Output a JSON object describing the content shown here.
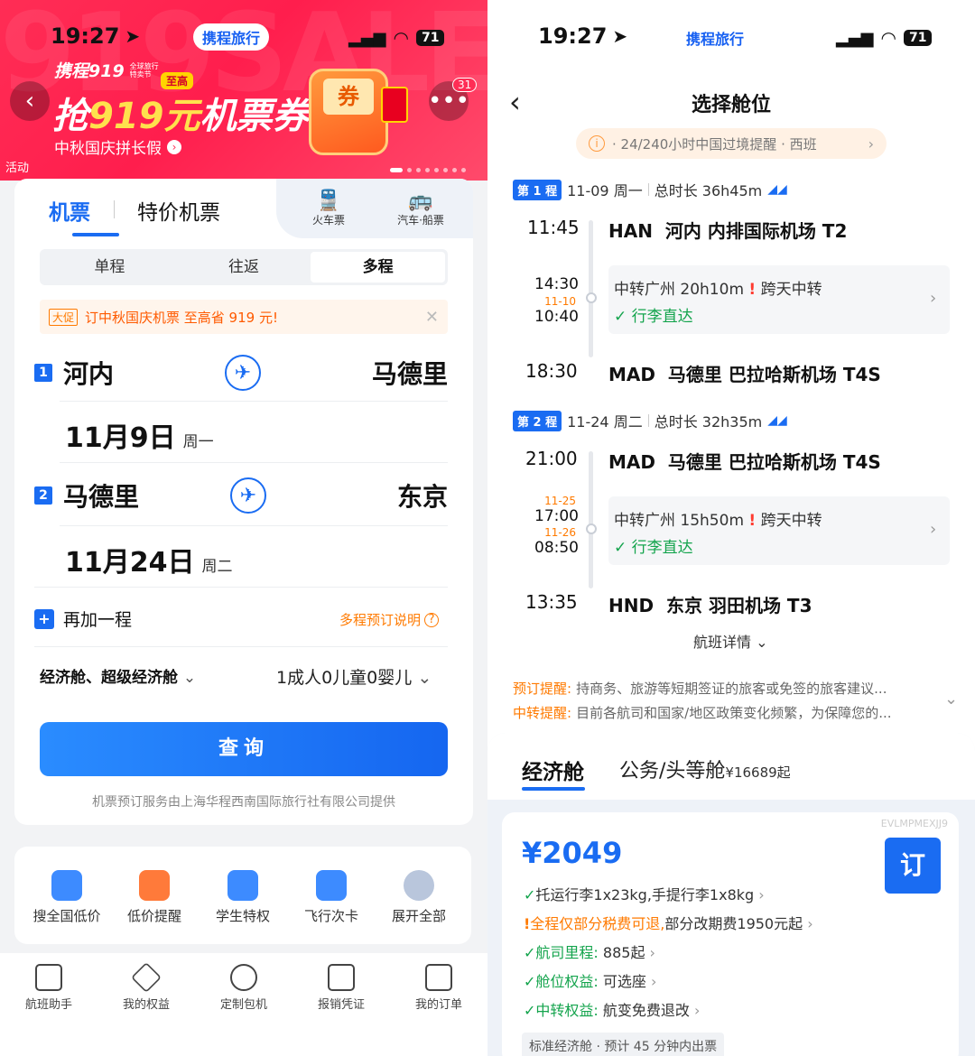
{
  "left": {
    "status": {
      "time": "19:27",
      "app": "携程旅行",
      "battery": "71"
    },
    "banner": {
      "brand": "携程919",
      "brand_sub": "全球旅行特卖节",
      "badge": "至高",
      "headline_pre": "抢",
      "headline_num": "919元",
      "headline_post": "机票券!",
      "sub": "中秋国庆拼长假",
      "tag": "活动",
      "notif_count": "31",
      "coupon_text": "券"
    },
    "tabs": {
      "flight": "机票",
      "special": "特价机票",
      "train": "火车票",
      "bus": "汽车·船票"
    },
    "trip_types": [
      "单程",
      "往返",
      "多程"
    ],
    "promo": {
      "tag": "大促",
      "text": "订中秋国庆机票 至高省 919 元!"
    },
    "legs": [
      {
        "num": "1",
        "from": "河内",
        "to": "马德里",
        "date": "11月9日",
        "weekday": "周一"
      },
      {
        "num": "2",
        "from": "马德里",
        "to": "东京",
        "date": "11月24日",
        "weekday": "周二"
      }
    ],
    "add_leg": "再加一程",
    "multi_help": "多程预订说明",
    "cabin": "经济舱、超级经济舱",
    "passengers": "1成人0儿童0婴儿",
    "search_btn": "查询",
    "provider": "机票预订服务由上海华程西南国际旅行社有限公司提供",
    "entries": [
      "搜全国低价",
      "低价提醒",
      "学生特权",
      "飞行次卡",
      "展开全部"
    ],
    "bottom_tabs": [
      "航班助手",
      "我的权益",
      "定制包机",
      "报销凭证",
      "我的订单"
    ]
  },
  "right": {
    "status": {
      "time": "19:27",
      "app": "携程旅行",
      "battery": "71"
    },
    "title": "选择舱位",
    "notice": "· 24/240小时中国过境提醒 · 西班",
    "segments": [
      {
        "badge": "第 1 程",
        "date": "11-09 周一",
        "duration": "总时长 36h45m",
        "dep_time": "11:45",
        "dep_airport": "HAN  河内 内排国际机场 T2",
        "tr_arr_time": "14:30",
        "tr_dep_date": "11-10",
        "tr_dep_time": "10:40",
        "tr_arr_date": "",
        "transfer": "中转广州 20h10m",
        "transfer_warn": "跨天中转",
        "baggage": "行李直达",
        "arr_time": "18:30",
        "arr_airport": "MAD  马德里 巴拉哈斯机场 T4S"
      },
      {
        "badge": "第 2 程",
        "date": "11-24 周二",
        "duration": "总时长 32h35m",
        "dep_time": "21:00",
        "dep_airport": "MAD  马德里 巴拉哈斯机场 T4S",
        "tr_arr_date": "11-25",
        "tr_arr_time": "17:00",
        "tr_dep_date": "11-26",
        "tr_dep_time": "08:50",
        "transfer": "中转广州 15h50m",
        "transfer_warn": "跨天中转",
        "baggage": "行李直达",
        "arr_time": "13:35",
        "arr_airport": "HND  东京 羽田机场 T3"
      }
    ],
    "flight_detail": "航班详情",
    "tips": [
      {
        "label": "预订提醒:",
        "text": "持商务、旅游等短期签证的旅客或免签的旅客建议..."
      },
      {
        "label": "中转提醒:",
        "text": "目前各航司和国家/地区政策变化频繁，为保障您的..."
      }
    ],
    "cabin_tabs": {
      "economy": "经济舱",
      "business": "公务/头等舱",
      "business_price": "¥16689起"
    },
    "fare": {
      "code": "EVLMPMEXJJ9",
      "price": "¥2049",
      "book": "订",
      "lines": [
        {
          "icon": "✓",
          "label": "",
          "text": "托运行李1x23kg,手提行李1x8kg"
        },
        {
          "icon": "!",
          "label": "全程仅部分税费可退,",
          "text": "部分改期费1950元起"
        },
        {
          "icon": "✓",
          "label": "航司里程:",
          "text": " 885起"
        },
        {
          "icon": "✓",
          "label": "舱位权益:",
          "text": " 可选座"
        },
        {
          "icon": "✓",
          "label": "中转权益:",
          "text": " 航变免费退改"
        }
      ],
      "footer": "标准经济舱 · 预计 45 分钟内出票"
    }
  }
}
